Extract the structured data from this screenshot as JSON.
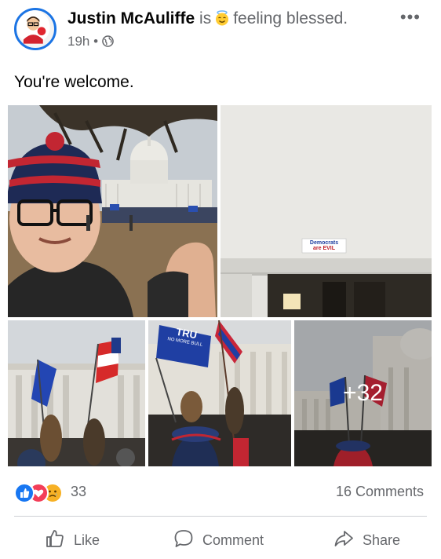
{
  "post": {
    "author": "Justin McAuliffe",
    "activity_prefix": "is",
    "feeling_icon": "halo-smile-icon",
    "feeling": "feeling blessed.",
    "time": "19h",
    "separator": "•",
    "privacy_icon": "globe-icon",
    "menu_icon": "more-options-icon",
    "more_label": "•••",
    "caption": "You're welcome."
  },
  "photos": {
    "sign_text_line1": "Democrats",
    "sign_text_line2": "are EVIL",
    "flag_text_line1": "TRU",
    "flag_text_line2": "NO MORE BULL",
    "more_count_label": "+32"
  },
  "reactions": {
    "icons": [
      "like-reaction-icon",
      "love-reaction-icon",
      "sad-reaction-icon"
    ],
    "count": "33",
    "comments": "16 Comments"
  },
  "actions": {
    "like": "Like",
    "comment": "Comment",
    "share": "Share"
  },
  "colors": {
    "accent": "#1b74e4",
    "like": "#1877f2",
    "love": "#f33e58",
    "sad": "#f7b125",
    "secondary_text": "#65676b"
  }
}
